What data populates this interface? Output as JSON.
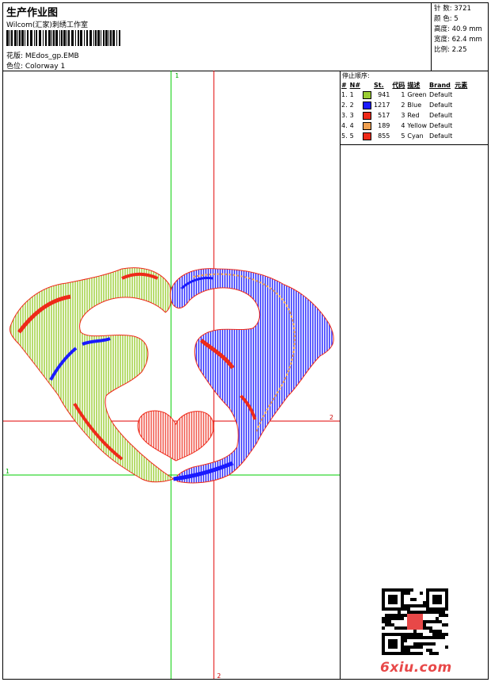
{
  "header": {
    "title": "生产作业图",
    "company": "Wilcom(汇家)刺绣工作室",
    "design_line": "花版:  MEdos_gp.EMB",
    "colorway_line": "色位:  Colorway 1"
  },
  "stats": {
    "stitches": "针 数: 3721",
    "colors": "颜 色: 5",
    "height": "高度: 40.9 mm",
    "width": "宽度: 62.4 mm",
    "scale": "比例: 2.25"
  },
  "guides": {
    "label_1_top": "1",
    "label_1_left": "1",
    "label_2_right": "2",
    "label_2_bottom": "2"
  },
  "stop_sequence": {
    "title": "停止顺序:",
    "columns": [
      "#",
      "N#",
      "St.",
      "代码",
      "描述",
      "Brand",
      "元素"
    ],
    "rows": [
      {
        "idx": "1.",
        "n": "1",
        "color": "#9acd32",
        "st": "941",
        "code": "1",
        "desc": "Green",
        "brand": "Default"
      },
      {
        "idx": "2.",
        "n": "2",
        "color": "#1a1aff",
        "st": "1217",
        "code": "2",
        "desc": "Blue",
        "brand": "Default"
      },
      {
        "idx": "3.",
        "n": "3",
        "color": "#ee2a1a",
        "st": "517",
        "code": "3",
        "desc": "Red",
        "brand": "Default"
      },
      {
        "idx": "4.",
        "n": "4",
        "color": "#f0a050",
        "st": "189",
        "code": "4",
        "desc": "Yellow",
        "brand": "Default"
      },
      {
        "idx": "5.",
        "n": "5",
        "color": "#ee2a1a",
        "st": "855",
        "code": "5",
        "desc": "Cyan",
        "brand": "Default"
      }
    ]
  },
  "colors": {
    "guide_green": "#00cc00",
    "guide_red": "#e00000",
    "thread_green": "#9acd32",
    "thread_blue": "#1a1aff",
    "thread_red": "#ee2a1a",
    "thread_orange": "#f0a050",
    "brand_red": "#e84848"
  },
  "watermark": {
    "qr_icon": "qr-code-icon",
    "brand_text": "6xiu.com"
  }
}
